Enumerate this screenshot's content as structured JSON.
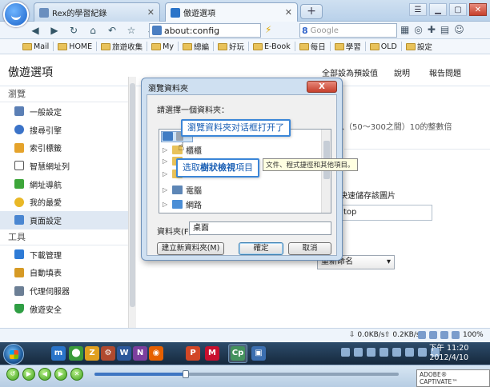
{
  "browser": {
    "tabs": [
      {
        "label": "Rex的學習紀錄",
        "active": false
      },
      {
        "label": "傲遊選項",
        "active": true
      }
    ],
    "new_tab": "+",
    "address": "about:config",
    "search_engine": "Google",
    "search_placeholder": "Google"
  },
  "bookmarks": [
    "Mail",
    "HOME",
    "旅遊收集",
    "My",
    "總編",
    "好玩",
    "E-Book",
    "每日",
    "學習",
    "OLD",
    "設定"
  ],
  "options_page": {
    "title": "傲遊選項",
    "header_links": [
      "全部設為預設值",
      "說明",
      "報告問題"
    ],
    "sections": [
      {
        "label": "瀏覽",
        "items": [
          {
            "label": "一般設定",
            "icon": "general-settings-icon",
            "color": "#5b7fb5"
          },
          {
            "label": "搜尋引擎",
            "icon": "magnifier-icon",
            "color": "#3b73c8"
          },
          {
            "label": "索引標籤",
            "icon": "tab-icon",
            "color": "#e5a32b"
          },
          {
            "label": "智慧網址列",
            "icon": "addressbar-icon",
            "color": "#555555"
          },
          {
            "label": "網址導航",
            "icon": "navigation-icon",
            "color": "#3da63a"
          },
          {
            "label": "我的最愛",
            "icon": "star-icon",
            "color": "#e9b827"
          },
          {
            "label": "頁面設定",
            "icon": "page-icon",
            "color": "#4a86d1",
            "selected": true
          }
        ]
      },
      {
        "label": "工具",
        "items": [
          {
            "label": "下載管理",
            "icon": "download-icon",
            "color": "#2e7bd6"
          },
          {
            "label": "自動填表",
            "icon": "key-icon",
            "color": "#d69a25"
          },
          {
            "label": "代理伺服器",
            "icon": "proxy-icon",
            "color": "#6c7f95"
          },
          {
            "label": "傲遊安全",
            "icon": "shield-icon",
            "color": "#2f9e44"
          }
        ]
      }
    ],
    "background_texts": {
      "range_hint": "輸入（50～300之間）10的整數倍",
      "save_images": "快速儲存該圖片",
      "path_value": "top",
      "rename_select": "重新命名"
    }
  },
  "dialog": {
    "title": "瀏覽資料夾",
    "close": "X",
    "prompt": "請選擇一個資料夾：",
    "tree": [
      {
        "label": "桌面",
        "level": 0,
        "icon": "desktop-icon",
        "color": "#3f7cc4"
      },
      {
        "label": "櫃櫃",
        "level": 1,
        "icon": "folder-icon",
        "color": "#e8c25a"
      },
      {
        "label": "",
        "level": 1,
        "icon": "folder-icon",
        "color": "#e8c25a"
      },
      {
        "label": "",
        "level": 1,
        "icon": "folder-icon",
        "color": "#e8c25a"
      },
      {
        "label": "電腦",
        "level": 1,
        "icon": "computer-icon",
        "color": "#5d86b6"
      },
      {
        "label": "網路",
        "level": 1,
        "icon": "network-icon",
        "color": "#4b8ed6"
      }
    ],
    "tree_tooltip": "文件、程式捷徑和其他項目。",
    "folder_label": "資料夾(F):",
    "folder_value": "桌面",
    "buttons": {
      "new_folder": "建立新資料夾(M)",
      "ok": "確定",
      "cancel": "取消"
    }
  },
  "callouts": {
    "first": "瀏覽資料夾对话框打开了",
    "second_prefix": "选取",
    "second_bold": "樹狀檢視",
    "second_suffix": "項目"
  },
  "status": {
    "down": "0.0KB/s",
    "up": "0.2KB/s",
    "zoom": "100%"
  },
  "taskbar": {
    "time": "下午 11:20",
    "date": "2012/4/10",
    "icons": [
      {
        "name": "maxthon-taskbar-icon",
        "glyph": "m",
        "color": "#2a74c9"
      },
      {
        "name": "chrome-taskbar-icon",
        "glyph": "⬤",
        "color": "#3a9b3a"
      },
      {
        "name": "zoom-taskbar-icon",
        "glyph": "Z",
        "color": "#e0a020"
      },
      {
        "name": "tool-taskbar-icon",
        "glyph": "⚙",
        "color": "#b04a2f"
      },
      {
        "name": "word-taskbar-icon",
        "glyph": "W",
        "color": "#2b579a"
      },
      {
        "name": "onenote-taskbar-icon",
        "glyph": "N",
        "color": "#7b3f9e"
      },
      {
        "name": "firefox-taskbar-icon",
        "glyph": "◉",
        "color": "#e66000"
      },
      {
        "name": "ppt-taskbar-icon",
        "glyph": "P",
        "color": "#d24726"
      },
      {
        "name": "media-taskbar-icon",
        "glyph": "M",
        "color": "#c8102e"
      },
      {
        "name": "captivate-taskbar-icon",
        "glyph": "Cp",
        "color": "#1b7a3a"
      },
      {
        "name": "app-taskbar-icon",
        "glyph": "▣",
        "color": "#3c6fb0"
      }
    ]
  },
  "playbar": {
    "progress": 0.3,
    "brand": "ADOBE® CAPTIVATE™"
  }
}
